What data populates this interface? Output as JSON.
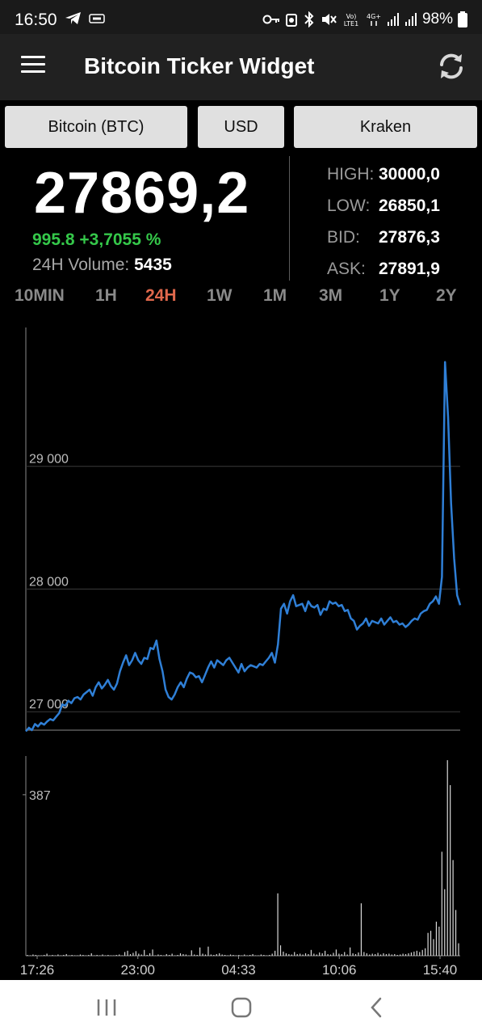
{
  "status_bar": {
    "time": "16:50",
    "battery": "98%",
    "icons": [
      "telegram-icon",
      "notification-icon",
      "key-icon",
      "sync-icon",
      "bluetooth-icon",
      "mute-icon",
      "volte-icon",
      "4g-icon",
      "signal-icon",
      "signal-icon",
      "battery-icon"
    ]
  },
  "app_bar": {
    "title": "Bitcoin Ticker Widget",
    "menu_icon": "menu-icon",
    "refresh_icon": "refresh-icon"
  },
  "selectors": {
    "coin": "Bitcoin (BTC)",
    "currency": "USD",
    "exchange": "Kraken"
  },
  "price": {
    "last": "27869,2",
    "change": "995.8 +3,7055 %",
    "volume_label": "24H Volume:",
    "volume_value": "5435"
  },
  "stats": {
    "high_label": "HIGH:",
    "high": "30000,0",
    "low_label": "LOW:",
    "low": "26850,1",
    "bid_label": "BID:",
    "bid": "27876,3",
    "ask_label": "ASK:",
    "ask": "27891,9"
  },
  "ranges": [
    "10MIN",
    "1H",
    "24H",
    "1W",
    "1M",
    "3M",
    "1Y",
    "2Y"
  ],
  "active_range": "24H",
  "colors": {
    "accent": "#e0684c",
    "positive": "#35c84a",
    "line": "#2f7fd6",
    "selector_bg": "#e0e0e0"
  },
  "chart_data": [
    {
      "type": "line",
      "ylim": [
        26850,
        30000
      ],
      "yticks": [
        27000,
        28000,
        29000
      ],
      "ytick_labels": [
        "27 000",
        "28 000",
        "29 000"
      ],
      "grid": true,
      "series": [
        {
          "values": [
            26840,
            26870,
            26850,
            26900,
            26880,
            26910,
            26895,
            26920,
            26940,
            26930,
            26960,
            26990,
            27060,
            27050,
            27090,
            27070,
            27110,
            27120,
            27100,
            27140,
            27160,
            27180,
            27130,
            27200,
            27240,
            27190,
            27220,
            27260,
            27210,
            27180,
            27230,
            27330,
            27400,
            27460,
            27380,
            27420,
            27480,
            27420,
            27390,
            27440,
            27430,
            27520,
            27510,
            27580,
            27430,
            27330,
            27180,
            27120,
            27100,
            27140,
            27200,
            27240,
            27200,
            27270,
            27320,
            27310,
            27280,
            27290,
            27240,
            27300,
            27360,
            27410,
            27360,
            27420,
            27400,
            27380,
            27420,
            27440,
            27400,
            27360,
            27320,
            27390,
            27330,
            27360,
            27380,
            27370,
            27360,
            27390,
            27380,
            27410,
            27440,
            27480,
            27400,
            27550,
            27840,
            27880,
            27800,
            27900,
            27950,
            27860,
            27870,
            27880,
            27820,
            27900,
            27860,
            27850,
            27870,
            27790,
            27840,
            27830,
            27900,
            27880,
            27890,
            27860,
            27870,
            27820,
            27830,
            27760,
            27740,
            27670,
            27700,
            27720,
            27760,
            27700,
            27740,
            27730,
            27720,
            27760,
            27710,
            27740,
            27770,
            27730,
            27740,
            27710,
            27720,
            27690,
            27710,
            27740,
            27760,
            27750,
            27800,
            27820,
            27830,
            27880,
            27900,
            27940,
            27880,
            28100,
            29850,
            29400,
            28700,
            28250,
            27950,
            27869
          ]
        }
      ]
    },
    {
      "type": "bar",
      "ylim": [
        0,
        480
      ],
      "yticks": [
        387
      ],
      "ytick_labels": [
        "387"
      ],
      "xtick_labels": [
        "17:26",
        "23:00",
        "04:33",
        "10:06",
        "15:40"
      ],
      "series": [
        {
          "values": [
            2,
            1,
            3,
            2,
            1,
            1,
            2,
            5,
            1,
            2,
            1,
            3,
            1,
            2,
            4,
            1,
            2,
            1,
            1,
            3,
            2,
            1,
            2,
            6,
            1,
            2,
            1,
            3,
            1,
            2,
            1,
            1,
            2,
            3,
            1,
            9,
            12,
            4,
            7,
            11,
            5,
            3,
            14,
            2,
            6,
            15,
            1,
            3,
            2,
            1,
            4,
            2,
            5,
            1,
            2,
            6,
            4,
            3,
            1,
            13,
            3,
            2,
            20,
            5,
            3,
            22,
            3,
            2,
            4,
            6,
            3,
            2,
            1,
            3,
            2,
            1,
            2,
            1,
            3,
            1,
            2,
            4,
            1,
            1,
            3,
            2,
            1,
            2,
            5,
            12,
            150,
            25,
            10,
            6,
            4,
            3,
            9,
            4,
            5,
            3,
            6,
            4,
            14,
            5,
            3,
            8,
            6,
            12,
            4,
            3,
            7,
            15,
            5,
            4,
            9,
            3,
            20,
            6,
            4,
            8,
            126,
            9,
            6,
            3,
            5,
            4,
            7,
            3,
            6,
            4,
            5,
            3,
            4,
            2,
            3,
            5,
            4,
            6,
            8,
            10,
            12,
            9,
            14,
            18,
            55,
            60,
            40,
            82,
            70,
            250,
            160,
            470,
            410,
            230,
            110,
            30
          ]
        }
      ]
    }
  ]
}
